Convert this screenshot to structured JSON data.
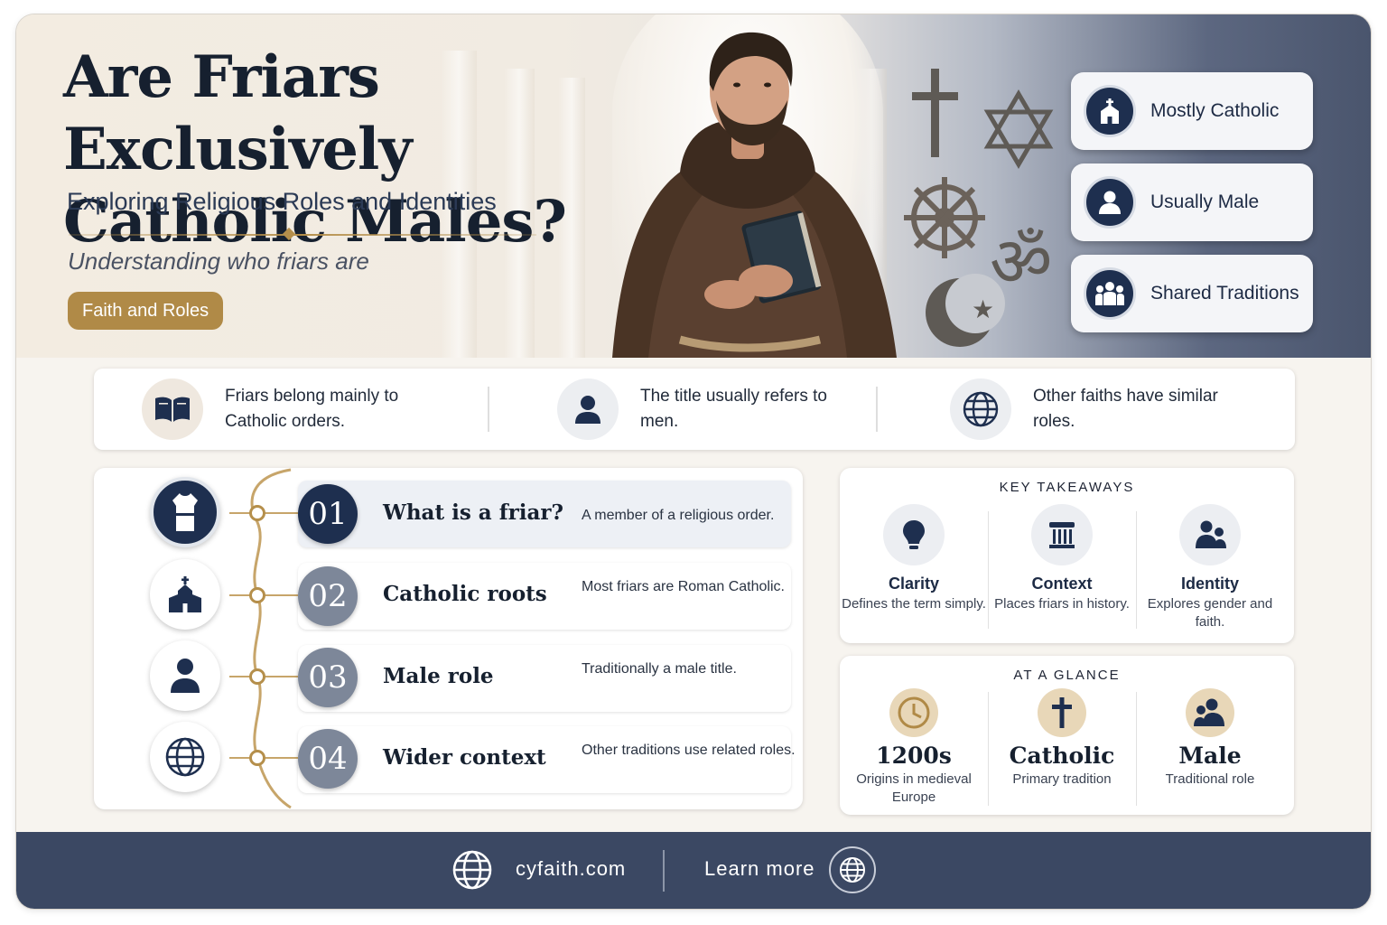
{
  "hero": {
    "title": "Are Friars Exclusively\nCatholic Males?",
    "subtitle": "Exploring Religious Roles and Identities",
    "tagline": "Understanding who friars are",
    "pill": "Faith and Roles",
    "badges": [
      {
        "label": "Mostly Catholic",
        "icon": "church-icon"
      },
      {
        "label": "Usually Male",
        "icon": "person-icon"
      },
      {
        "label": "Shared Traditions",
        "icon": "group-icon"
      }
    ]
  },
  "strip": [
    {
      "text": "Friars belong mainly to Catholic orders.",
      "icon": "book-icon"
    },
    {
      "text": "The title usually refers to men.",
      "icon": "person-icon"
    },
    {
      "text": "Other faiths have similar roles.",
      "icon": "globe-icon"
    }
  ],
  "timeline": [
    {
      "num": "01",
      "title": "What is a friar?",
      "desc": "A member of a religious order.",
      "icon": "robe-icon"
    },
    {
      "num": "02",
      "title": "Catholic roots",
      "desc": "Most friars are Roman Catholic.",
      "icon": "church-icon"
    },
    {
      "num": "03",
      "title": "Male role",
      "desc": "Traditionally a male title.",
      "icon": "person-icon"
    },
    {
      "num": "04",
      "title": "Wider context",
      "desc": "Other traditions use related roles.",
      "icon": "globe-icon"
    }
  ],
  "takeaways": {
    "title": "KEY TAKEAWAYS",
    "items": [
      {
        "title": "Clarity",
        "desc": "Defines the term simply.",
        "icon": "lightbulb-icon"
      },
      {
        "title": "Context",
        "desc": "Places friars in history.",
        "icon": "column-icon"
      },
      {
        "title": "Identity",
        "desc": "Explores gender and faith.",
        "icon": "people-icon"
      }
    ]
  },
  "glance": {
    "title": "AT A GLANCE",
    "items": [
      {
        "value": "1200s",
        "desc": "Origins in medieval Europe",
        "icon": "clock-icon"
      },
      {
        "value": "Catholic",
        "desc": "Primary tradition",
        "icon": "cross-icon"
      },
      {
        "value": "Male",
        "desc": "Traditional role",
        "icon": "people-icon"
      }
    ]
  },
  "footer": {
    "site": "cyfaith.com",
    "cta": "Learn more"
  },
  "colors": {
    "navy": "#1e2f4f",
    "gold": "#b08a47",
    "footer": "#3b4863"
  }
}
